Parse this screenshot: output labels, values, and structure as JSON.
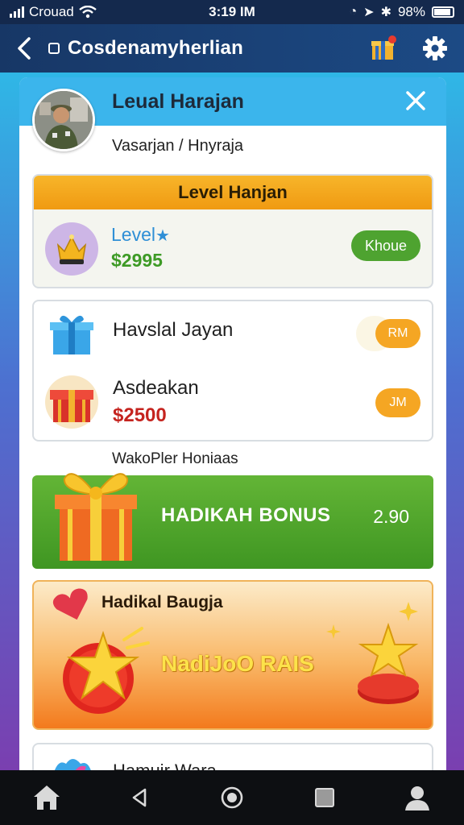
{
  "status_bar": {
    "carrier": "Crouad",
    "time": "3:19 IM",
    "battery": "98%"
  },
  "app_bar": {
    "title": "Cosdenamyherlian"
  },
  "panel": {
    "title": "Leual Harajan",
    "subtitle": "Vasarjan / Hnyraja"
  },
  "level_card": {
    "header": "Level Hanjan",
    "level_label": "Level",
    "price": "$2995",
    "button_label": "Khoue"
  },
  "gift_card": {
    "items": [
      {
        "title": "Havslal Jayan",
        "price": "",
        "button_label": "RM",
        "icon": "blue-gift-box-icon"
      },
      {
        "title": "Asdeakan",
        "price": "$2500",
        "button_label": "JM",
        "icon": "red-gift-box-icon"
      }
    ]
  },
  "section_label": "WakoPler Honiaas",
  "bonus_banner": {
    "text": "HADIKAH BONUS",
    "amount": "2.90"
  },
  "promo_card": {
    "title": "Hadikal Baugja",
    "center_text": "NadiJoO RAIS"
  },
  "bottom_card": {
    "title": "Hamuir Wara"
  },
  "nav": [
    "home-icon",
    "back-triangle-icon",
    "home-circle-icon",
    "recents-square-icon",
    "profile-icon"
  ],
  "colors": {
    "accent": "#3bb5ec",
    "green": "#4ea330",
    "orange": "#f5a623",
    "price_red": "#c5241f",
    "price_green": "#3d9a25"
  }
}
